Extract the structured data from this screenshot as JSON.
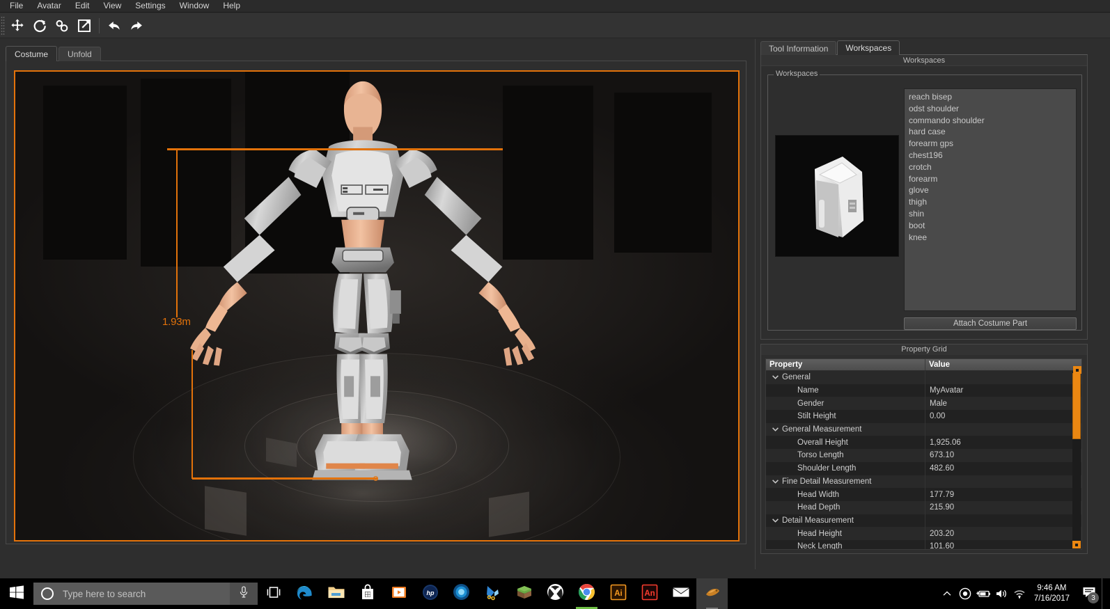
{
  "menubar": {
    "items": [
      {
        "label": "File"
      },
      {
        "label": "Avatar"
      },
      {
        "label": "Edit"
      },
      {
        "label": "View"
      },
      {
        "label": "Settings"
      },
      {
        "label": "Window"
      },
      {
        "label": "Help"
      }
    ]
  },
  "toolbar": {
    "buttons": [
      {
        "icon": "move-icon",
        "name": "move-tool"
      },
      {
        "icon": "rotate-icon",
        "name": "rotate-tool"
      },
      {
        "icon": "link-icon",
        "name": "link-tool"
      },
      {
        "icon": "export-icon",
        "name": "export-tool"
      },
      {
        "icon": "undo-icon",
        "name": "undo-button"
      },
      {
        "icon": "redo-icon",
        "name": "redo-button"
      }
    ]
  },
  "left_tabs": [
    {
      "label": "Costume",
      "active": true
    },
    {
      "label": "Unfold",
      "active": false
    }
  ],
  "viewport": {
    "measurement_label": "1.93m",
    "accent_color": "#e3720a",
    "background_color": "#161412"
  },
  "right_tabs": [
    {
      "label": "Tool Information",
      "active": false
    },
    {
      "label": "Workspaces",
      "active": true
    }
  ],
  "workspaces_panel": {
    "caption": "Workspaces",
    "groupbox_title": "Workspaces",
    "items": [
      "reach bisep",
      "odst shoulder",
      "commando shoulder",
      "hard case",
      "forearm gps",
      "chest196",
      "crotch",
      "forearm",
      "glove",
      "thigh",
      "shin",
      "boot",
      "knee"
    ],
    "attach_button": "Attach Costume Part"
  },
  "property_grid": {
    "caption": "Property Grid",
    "columns": [
      "Property",
      "Value"
    ],
    "rows": [
      {
        "type": "group",
        "name": "General",
        "value": ""
      },
      {
        "type": "leaf",
        "name": "Name",
        "value": "MyAvatar"
      },
      {
        "type": "leaf",
        "name": "Gender",
        "value": "Male"
      },
      {
        "type": "leaf",
        "name": "Stilt Height",
        "value": "0.00"
      },
      {
        "type": "group",
        "name": "General Measurement",
        "value": ""
      },
      {
        "type": "leaf",
        "name": "Overall Height",
        "value": "1,925.06"
      },
      {
        "type": "leaf",
        "name": "Torso Length",
        "value": "673.10"
      },
      {
        "type": "leaf",
        "name": "Shoulder Length",
        "value": "482.60"
      },
      {
        "type": "group",
        "name": "Fine Detail Measurement",
        "value": ""
      },
      {
        "type": "leaf",
        "name": "Head Width",
        "value": "177.79"
      },
      {
        "type": "leaf",
        "name": "Head Depth",
        "value": "215.90"
      },
      {
        "type": "group",
        "name": "Detail Measurement",
        "value": ""
      },
      {
        "type": "leaf",
        "name": "Head Height",
        "value": "203.20"
      },
      {
        "type": "leaf",
        "name": "Neck Length",
        "value": "101.60"
      }
    ],
    "scrollbar_color": "#eb8712"
  },
  "taskbar": {
    "start": "start-button",
    "search_placeholder": "Type here to search",
    "icons": [
      {
        "name": "task-view-icon"
      },
      {
        "name": "edge-icon"
      },
      {
        "name": "file-explorer-icon"
      },
      {
        "name": "microsoft-store-icon"
      },
      {
        "name": "movies-tv-icon"
      },
      {
        "name": "hp-icon"
      },
      {
        "name": "blue-orb-icon"
      },
      {
        "name": "sync-app-icon"
      },
      {
        "name": "minecraft-icon"
      },
      {
        "name": "xbox-icon"
      },
      {
        "name": "chrome-icon"
      },
      {
        "name": "illustrator-icon",
        "label": "Ai"
      },
      {
        "name": "animate-icon",
        "label": "An"
      },
      {
        "name": "mail-icon"
      },
      {
        "name": "avatar-app-icon"
      }
    ],
    "tray": {
      "time": "9:46 AM",
      "date": "7/16/2017",
      "notification_count": "3"
    }
  }
}
